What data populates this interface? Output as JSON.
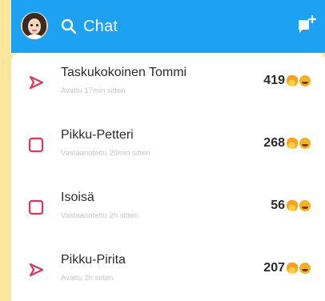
{
  "header": {
    "search_label": "Chat",
    "brand_color": "#1da1f2",
    "avatar_icon": "avatar-icon",
    "search_icon": "search-icon",
    "new_chat_icon": "new-chat-icon"
  },
  "chats": [
    {
      "name": "Taskukokoinen Tommi",
      "status_text": "Avattu 17min sitten",
      "streak": "419",
      "status_icon": "opened-arrow-icon",
      "status_color": "#e0345a"
    },
    {
      "name": "Pikku-Petteri",
      "status_text": "Vastaanotettu 29min sitten",
      "streak": "268",
      "status_icon": "received-square-icon",
      "status_color": "#e0345a"
    },
    {
      "name": "Isoisä",
      "status_text": "Vastaanotettu 2h sitten",
      "streak": "56",
      "status_icon": "received-square-icon",
      "status_color": "#e0345a"
    },
    {
      "name": "Pikku-Pirita",
      "status_text": "Avattu 2h sitten",
      "streak": "207",
      "status_icon": "opened-arrow-icon",
      "status_color": "#e0345a"
    }
  ]
}
